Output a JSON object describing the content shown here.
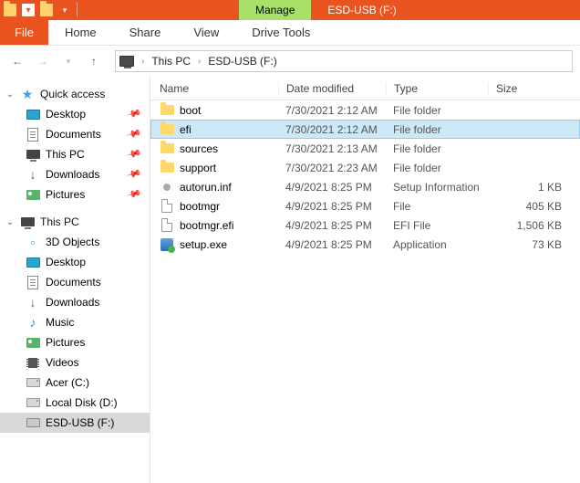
{
  "titlebar": {
    "manage_label": "Manage",
    "context_label": "ESD-USB (F:)"
  },
  "menu": {
    "file": "File",
    "home": "Home",
    "share": "Share",
    "view": "View",
    "drive_tools": "Drive Tools"
  },
  "breadcrumb": {
    "root": "This PC",
    "current": "ESD-USB (F:)"
  },
  "columns": {
    "name": "Name",
    "date": "Date modified",
    "type": "Type",
    "size": "Size"
  },
  "sidebar": {
    "quick": {
      "header": "Quick access",
      "items": [
        {
          "label": "Desktop",
          "icon": "desktop",
          "pinned": true
        },
        {
          "label": "Documents",
          "icon": "doc",
          "pinned": true
        },
        {
          "label": "This PC",
          "icon": "pc",
          "pinned": true
        },
        {
          "label": "Downloads",
          "icon": "down",
          "pinned": true
        },
        {
          "label": "Pictures",
          "icon": "pic",
          "pinned": true
        }
      ]
    },
    "thispc": {
      "header": "This PC",
      "items": [
        {
          "label": "3D Objects",
          "icon": "3d"
        },
        {
          "label": "Desktop",
          "icon": "desktop"
        },
        {
          "label": "Documents",
          "icon": "doc"
        },
        {
          "label": "Downloads",
          "icon": "down"
        },
        {
          "label": "Music",
          "icon": "music"
        },
        {
          "label": "Pictures",
          "icon": "pic"
        },
        {
          "label": "Videos",
          "icon": "video"
        },
        {
          "label": "Acer (C:)",
          "icon": "drive"
        },
        {
          "label": "Local Disk (D:)",
          "icon": "drive"
        },
        {
          "label": "ESD-USB (F:)",
          "icon": "usb",
          "selected": true
        }
      ]
    }
  },
  "files": [
    {
      "name": "boot",
      "date": "7/30/2021 2:12 AM",
      "type": "File folder",
      "size": "",
      "icon": "folder"
    },
    {
      "name": "efi",
      "date": "7/30/2021 2:12 AM",
      "type": "File folder",
      "size": "",
      "icon": "folder",
      "selected": true
    },
    {
      "name": "sources",
      "date": "7/30/2021 2:13 AM",
      "type": "File folder",
      "size": "",
      "icon": "folder"
    },
    {
      "name": "support",
      "date": "7/30/2021 2:23 AM",
      "type": "File folder",
      "size": "",
      "icon": "folder"
    },
    {
      "name": "autorun.inf",
      "date": "4/9/2021 8:25 PM",
      "type": "Setup Information",
      "size": "1 KB",
      "icon": "gear"
    },
    {
      "name": "bootmgr",
      "date": "4/9/2021 8:25 PM",
      "type": "File",
      "size": "405 KB",
      "icon": "file"
    },
    {
      "name": "bootmgr.efi",
      "date": "4/9/2021 8:25 PM",
      "type": "EFI File",
      "size": "1,506 KB",
      "icon": "file"
    },
    {
      "name": "setup.exe",
      "date": "4/9/2021 8:25 PM",
      "type": "Application",
      "size": "73 KB",
      "icon": "exe"
    }
  ]
}
